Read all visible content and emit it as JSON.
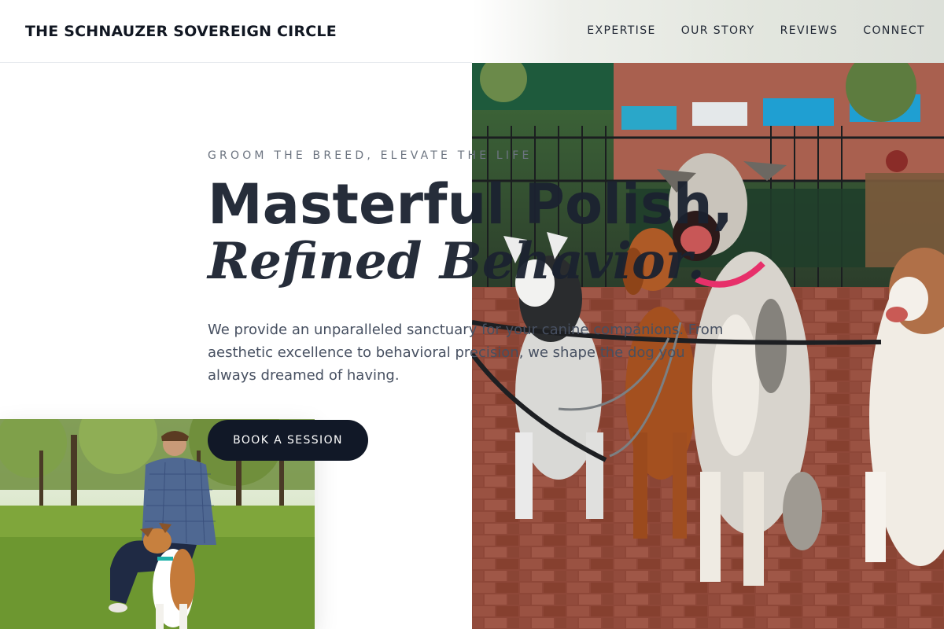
{
  "header": {
    "brand": "THE SCHNAUZER SOVEREIGN CIRCLE",
    "nav": [
      {
        "label": "EXPERTISE"
      },
      {
        "label": "OUR STORY"
      },
      {
        "label": "REVIEWS"
      },
      {
        "label": "CONNECT"
      }
    ]
  },
  "hero": {
    "eyebrow": "GROOM THE BREED, ELEVATE THE LIFE",
    "title_line1": "Masterful Polish,",
    "title_line2": "Refined Behavior.",
    "lede": "We provide an unparalleled sanctuary for your canine companions. From aesthetic excellence to behavioral precision, we shape the dog you always dreamed of having.",
    "cta_label": "BOOK A SESSION"
  },
  "colors": {
    "text_dark": "#1b2230",
    "cta_bg": "#111827",
    "muted": "#6c7480"
  },
  "images": {
    "hero_photo": "dogs-on-leashes-brick-plaza",
    "side_photo": "man-with-dog-in-park"
  }
}
